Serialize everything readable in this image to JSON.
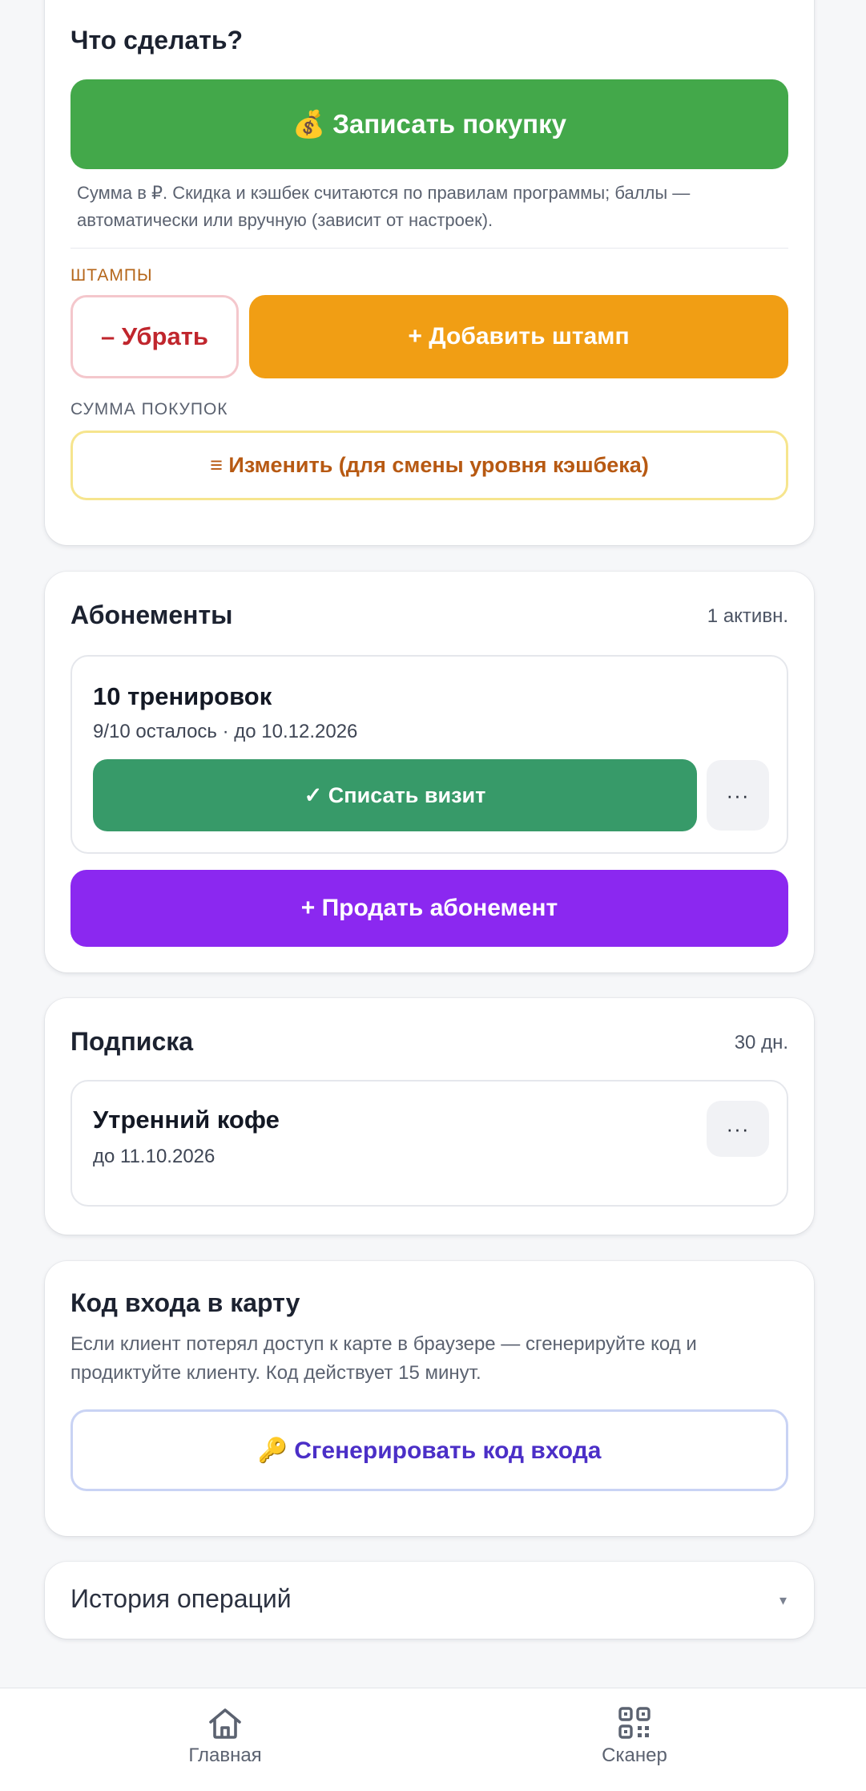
{
  "actions": {
    "title": "Что сделать?",
    "purchase_button": "💰 Записать покупку",
    "purchase_hint": "Сумма в ₽. Скидка и кэшбек считаются по правилам программы; баллы — автоматически или вручную (зависит от настроек).",
    "stamps_label": "ШТАМПЫ",
    "remove_stamp_button": "– Убрать",
    "add_stamp_button": "+ Добавить штамп",
    "sum_label": "СУММА ПОКУПОК",
    "change_sum_button": "≡ Изменить (для смены уровня кэшбека)"
  },
  "subscriptions": {
    "title": "Абонементы",
    "count": "1 активн.",
    "item": {
      "name": "10 тренировок",
      "details": "9/10 осталось · до 10.12.2026",
      "use_button": "✓ Списать визит",
      "more_label": "···"
    },
    "sell_button": "+ Продать абонемент"
  },
  "membership": {
    "title": "Подписка",
    "duration": "30 дн.",
    "item": {
      "name": "Утренний кофе",
      "details": "до 11.10.2026",
      "more_label": "···"
    }
  },
  "login_code": {
    "title": "Код входа в карту",
    "description": "Если клиент потерял доступ к карте в браузере — сгенерируйте код и продиктуйте клиенту. Код действует 15 минут.",
    "generate_button": "🔑 Сгенерировать код входа"
  },
  "history": {
    "title": "История операций",
    "chevron": "▾"
  },
  "tabbar": {
    "home_label": "Главная",
    "home_icon": "home-icon",
    "scanner_label": "Сканер",
    "scanner_icon": "qr-code-icon"
  },
  "colors": {
    "green": "#43a84a",
    "orange": "#f19e14",
    "purple": "#8b28f0",
    "visit_green": "#379a69",
    "indigo": "#4b2fc7"
  }
}
